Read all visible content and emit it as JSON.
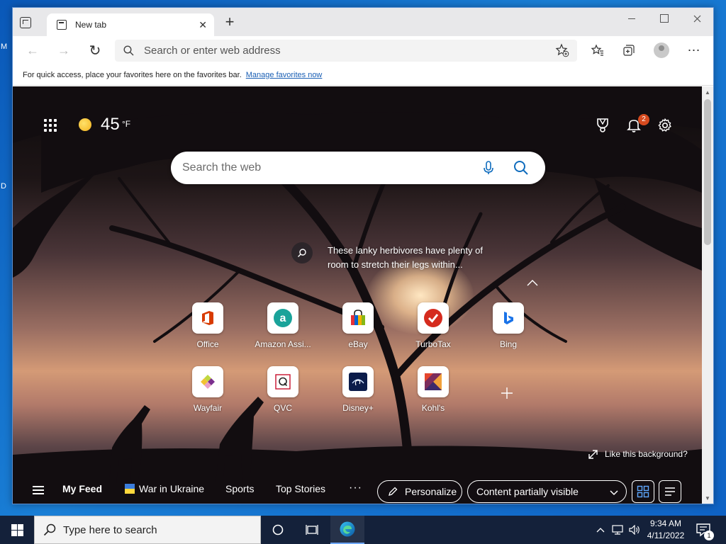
{
  "desktop": {
    "label_m": "M",
    "label_d": "D"
  },
  "tab": {
    "title": "New tab",
    "close": "✕"
  },
  "new_tab_glyph": "+",
  "toolbar": {
    "address_placeholder": "Search or enter web address",
    "back": "←",
    "forward": "→",
    "reload": "↻",
    "more": "⋯"
  },
  "favbar": {
    "text": "For quick access, place your favorites here on the favorites bar.",
    "link": "Manage favorites now"
  },
  "weather": {
    "temp": "45",
    "unit": "°F",
    "icon": "sun-icon"
  },
  "notifications": {
    "count": "2"
  },
  "search": {
    "placeholder": "Search the web"
  },
  "image_info": {
    "text": "These lanky herbivores have plenty of room to stretch their legs within..."
  },
  "quick_links": [
    {
      "label": "Office",
      "icon": "office-icon"
    },
    {
      "label": "Amazon Assi...",
      "icon": "amazon-assistant-icon"
    },
    {
      "label": "eBay",
      "icon": "ebay-icon"
    },
    {
      "label": "TurboTax",
      "icon": "turbotax-icon"
    },
    {
      "label": "Bing",
      "icon": "bing-icon"
    },
    {
      "label": "Wayfair",
      "icon": "wayfair-icon"
    },
    {
      "label": "QVC",
      "icon": "qvc-icon"
    },
    {
      "label": "Disney+",
      "icon": "disney-plus-icon"
    },
    {
      "label": "Kohl's",
      "icon": "kohls-icon"
    }
  ],
  "like_background": "Like this background?",
  "feed": {
    "my_feed": "My Feed",
    "war_in_ukraine": "War in Ukraine",
    "sports": "Sports",
    "top_stories": "Top Stories",
    "more": "···",
    "personalize": "Personalize",
    "content_visibility": "Content partially visible"
  },
  "taskbar": {
    "search_placeholder": "Type here to search",
    "time": "9:34 AM",
    "date": "4/11/2022",
    "notification_count": "1"
  },
  "colors": {
    "accent": "#0078d4",
    "office": "#d83b01",
    "amazon": "#1aa39a",
    "turbotax": "#d52b1e",
    "bing": "#1a73e8",
    "badge": "#d64a1f"
  }
}
